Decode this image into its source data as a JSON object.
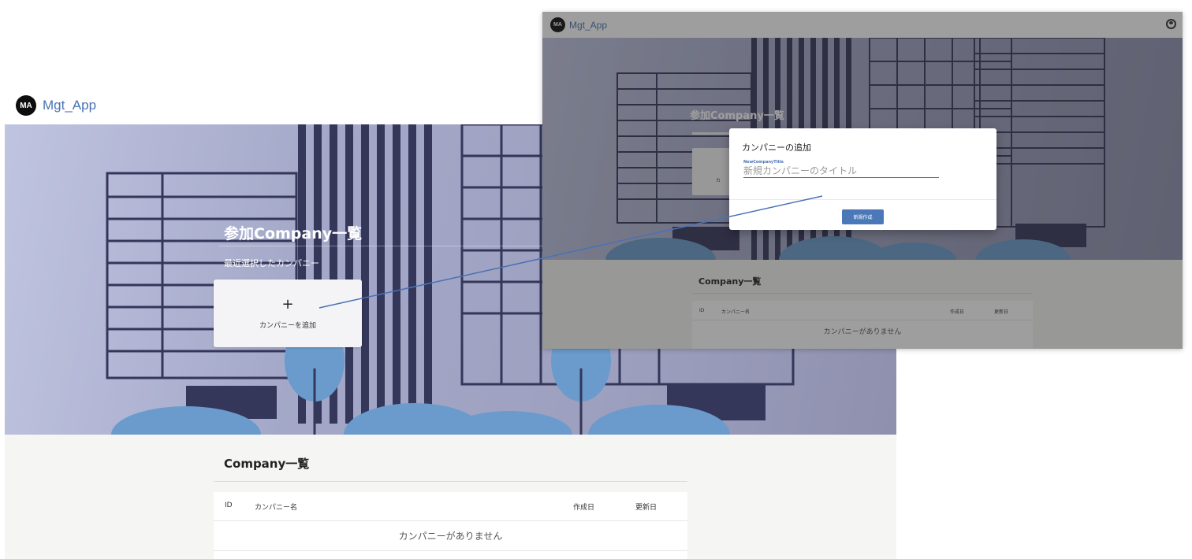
{
  "app": {
    "avatar_initials": "MA",
    "brand_name": "Mgt_App"
  },
  "hero": {
    "title": "参加Company一覧",
    "subtitle": "最近選択したカンパニー",
    "add_card": {
      "icon": "plus-icon",
      "label": "カンパニーを追加"
    }
  },
  "company_list": {
    "title": "Company一覧",
    "columns": [
      "ID",
      "カンパニー名",
      "作成日",
      "更新日"
    ],
    "empty_message": "カンパニーがありません"
  },
  "modal": {
    "title": "カンパニーの追加",
    "field_label": "NewCompanyTitle",
    "field_placeholder": "新規カンパニーのタイトル",
    "field_value": "",
    "submit_label": "新規作成"
  },
  "header_icons": {
    "user": "account-circle-icon"
  },
  "colors": {
    "brand": "#4a72b5",
    "accent_button": "#4a78b8",
    "connector_line": "#4a72b5"
  }
}
